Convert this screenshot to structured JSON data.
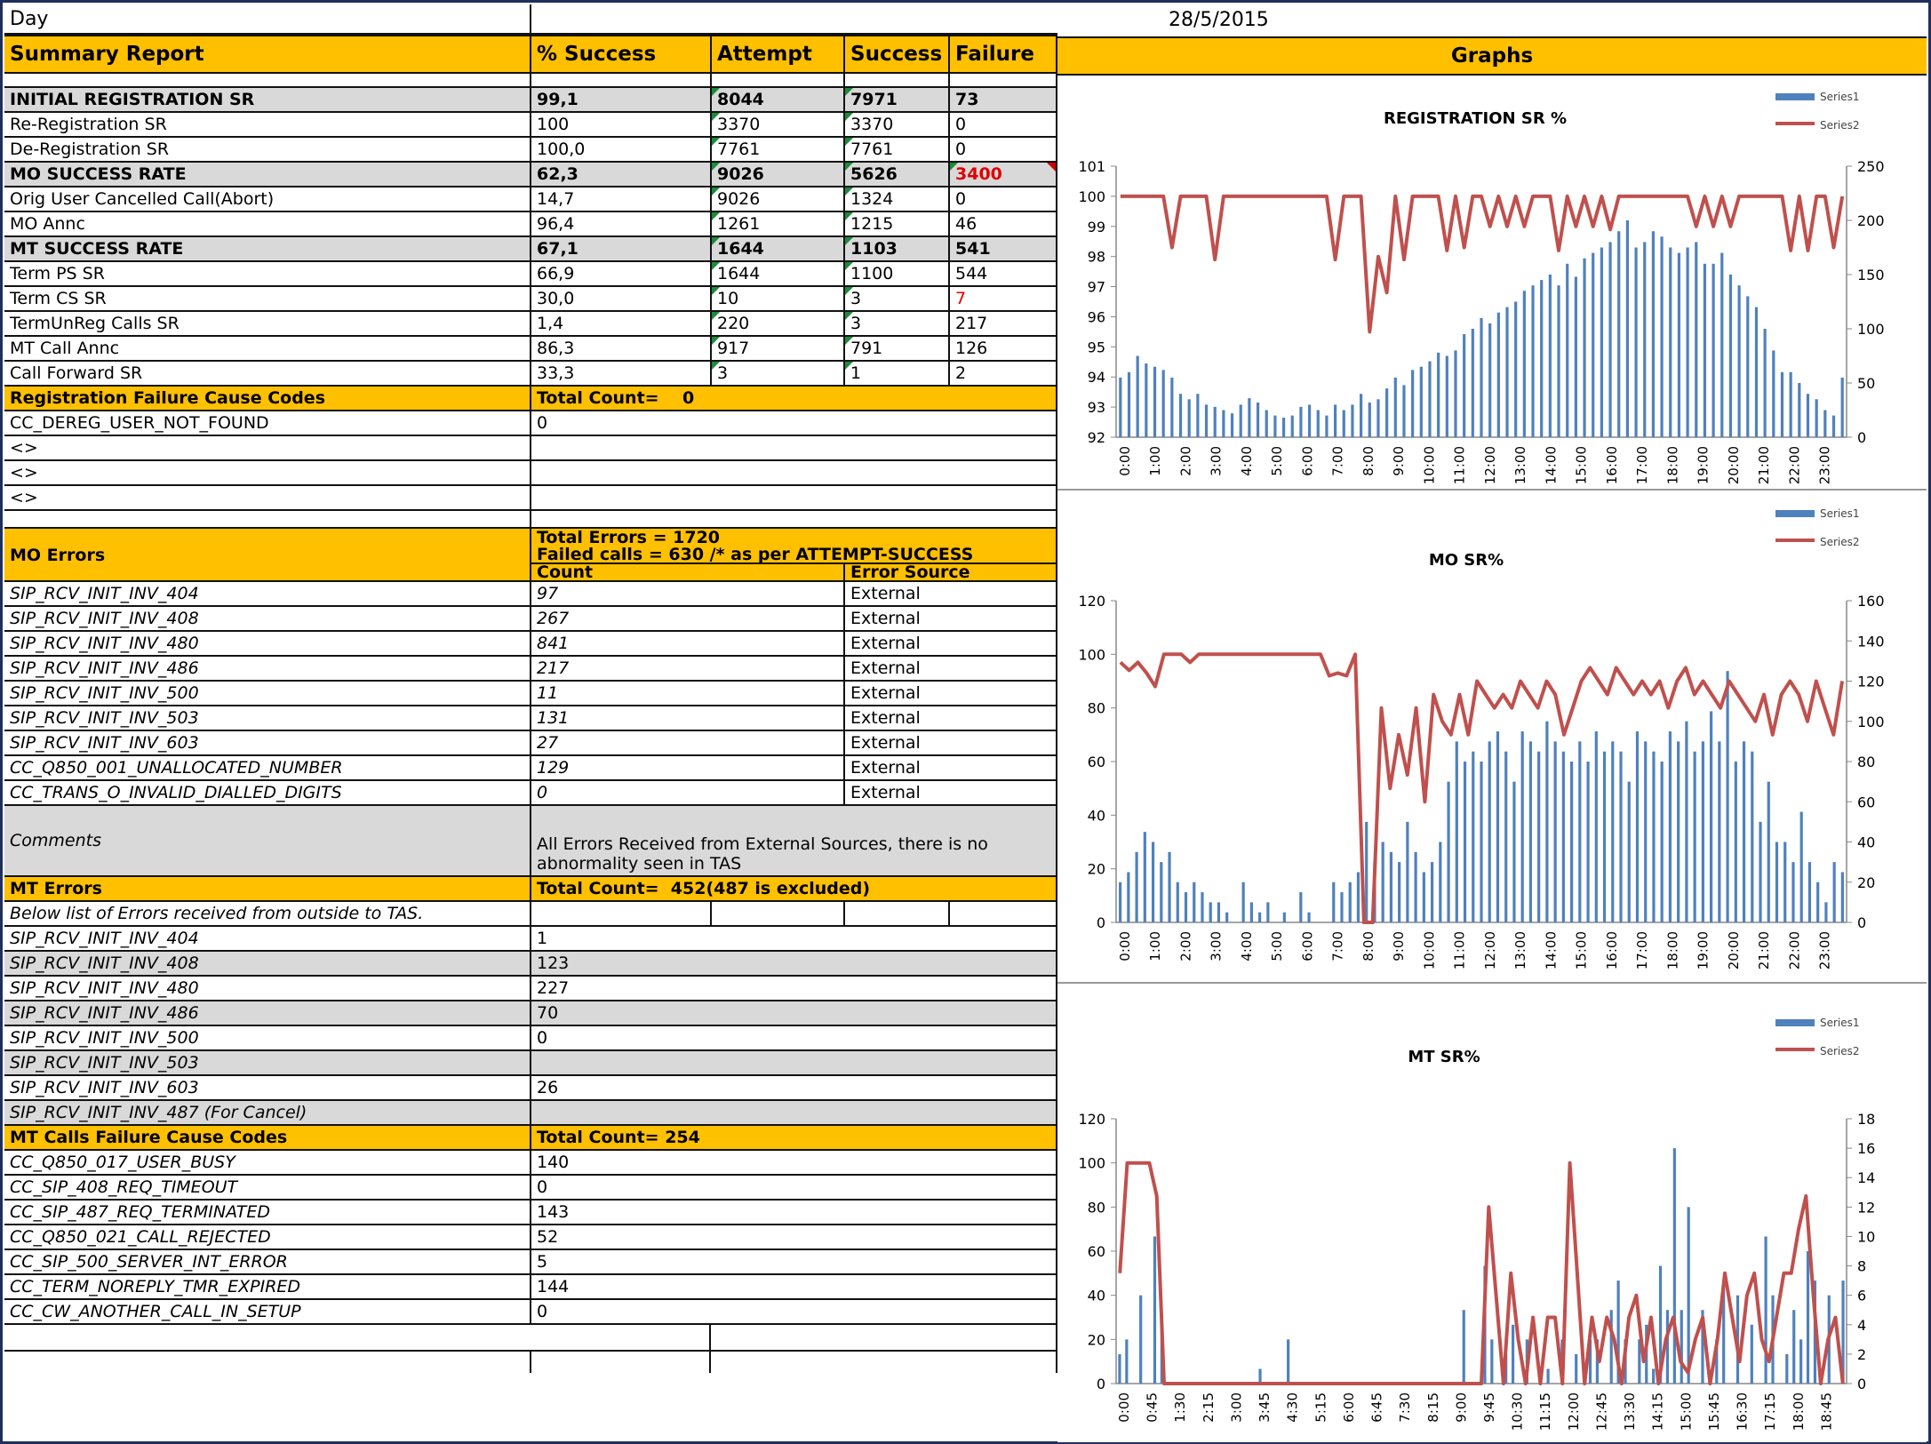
{
  "top": {
    "day_label": "Day",
    "date": "28/5/2015"
  },
  "summary": {
    "headers": [
      "Summary Report",
      "% Success",
      "Attempt",
      "Success",
      "Failure"
    ],
    "rows": [
      {
        "name": "INITIAL REGISTRATION SR",
        "pct": "99,1",
        "attempt": "8044",
        "success": "7971",
        "failure": "73",
        "bold": true
      },
      {
        "name": "Re-Registration SR",
        "pct": "100",
        "attempt": "3370",
        "success": "3370",
        "failure": "0"
      },
      {
        "name": "De-Registration SR",
        "pct": "100,0",
        "attempt": "7761",
        "success": "7761",
        "failure": "0"
      },
      {
        "name": "MO SUCCESS RATE",
        "pct": "62,3",
        "attempt": "9026",
        "success": "5626",
        "failure": "3400",
        "bold": true,
        "redfail": true
      },
      {
        "name": "Orig User Cancelled Call(Abort)",
        "pct": "14,7",
        "attempt": "9026",
        "success": "1324",
        "failure": "0"
      },
      {
        "name": "MO Annc",
        "pct": "96,4",
        "attempt": "1261",
        "success": "1215",
        "failure": "46"
      },
      {
        "name": "MT SUCCESS RATE",
        "pct": "67,1",
        "attempt": "1644",
        "success": "1103",
        "failure": "541",
        "bold": true
      },
      {
        "name": "Term PS SR",
        "pct": "66,9",
        "attempt": "1644",
        "success": "1100",
        "failure": "544"
      },
      {
        "name": "Term CS SR",
        "pct": "30,0",
        "attempt": "10",
        "success": "3",
        "failure": "7",
        "redfail": true
      },
      {
        "name": "TermUnReg Calls SR",
        "pct": "1,4",
        "attempt": "220",
        "success": "3",
        "failure": "217"
      },
      {
        "name": "MT Call Annc",
        "pct": "86,3",
        "attempt": "917",
        "success": "791",
        "failure": "126"
      },
      {
        "name": "Call Forward SR",
        "pct": "33,3",
        "attempt": "3",
        "success": "1",
        "failure": "2"
      }
    ]
  },
  "reg_fail": {
    "title": "Registration Failure Cause Codes",
    "total": "Total Count=    0",
    "rows": [
      {
        "code": "CC_DEREG_USER_NOT_FOUND",
        "value": "0"
      },
      {
        "code": "<>",
        "value": ""
      },
      {
        "code": "<>",
        "value": ""
      },
      {
        "code": "<>",
        "value": ""
      }
    ]
  },
  "mo_errors": {
    "title": "MO Errors",
    "total_errors": "Total Errors =  1720",
    "failed_calls": "Failed calls = 630 /* as per ATTEMPT-SUCCESS",
    "count_header": "Count",
    "source_header": "Error Source",
    "rows": [
      {
        "code": "SIP_RCV_INIT_INV_404",
        "count": "97",
        "source": "External"
      },
      {
        "code": "SIP_RCV_INIT_INV_408",
        "count": "267",
        "source": "External"
      },
      {
        "code": "SIP_RCV_INIT_INV_480",
        "count": "841",
        "source": "External"
      },
      {
        "code": "SIP_RCV_INIT_INV_486",
        "count": "217",
        "source": "External"
      },
      {
        "code": "SIP_RCV_INIT_INV_500",
        "count": "11",
        "source": "External"
      },
      {
        "code": "SIP_RCV_INIT_INV_503",
        "count": "131",
        "source": "External"
      },
      {
        "code": "SIP_RCV_INIT_INV_603",
        "count": "27",
        "source": "External"
      },
      {
        "code": "CC_Q850_001_UNALLOCATED_NUMBER",
        "count": "129",
        "source": "External"
      },
      {
        "code": "CC_TRANS_O_INVALID_DIALLED_DIGITS",
        "count": "0",
        "source": "External"
      }
    ],
    "comments_label": "Comments",
    "comments_line1": "All Errors Received from External Sources, there is no",
    "comments_line2": "abnormality seen in TAS"
  },
  "mt_errors": {
    "title": "MT Errors",
    "total": "Total Count=  452(487 is excluded)",
    "note": "Below list of Errors received from outside to TAS.",
    "rows": [
      {
        "code": "SIP_RCV_INIT_INV_404",
        "value": "1"
      },
      {
        "code": "SIP_RCV_INIT_INV_408",
        "value": "123"
      },
      {
        "code": "SIP_RCV_INIT_INV_480",
        "value": "227"
      },
      {
        "code": "SIP_RCV_INIT_INV_486",
        "value": "70"
      },
      {
        "code": "SIP_RCV_INIT_INV_500",
        "value": "0"
      },
      {
        "code": "SIP_RCV_INIT_INV_503",
        "value": ""
      },
      {
        "code": "SIP_RCV_INIT_INV_603",
        "value": "26"
      },
      {
        "code": "SIP_RCV_INIT_INV_487 (For Cancel)",
        "value": ""
      }
    ]
  },
  "mt_fail": {
    "title": "MT Calls Failure Cause Codes",
    "total": "Total Count= 254",
    "rows": [
      {
        "code": "CC_Q850_017_USER_BUSY",
        "value": "140"
      },
      {
        "code": "CC_SIP_408_REQ_TIMEOUT",
        "value": "0"
      },
      {
        "code": "CC_SIP_487_REQ_TERMINATED",
        "value": "143"
      },
      {
        "code": "CC_Q850_021_CALL_REJECTED",
        "value": "52"
      },
      {
        "code": "CC_SIP_500_SERVER_INT_ERROR",
        "value": "5"
      },
      {
        "code": "CC_TERM_NOREPLY_TMR_EXPIRED",
        "value": "144"
      },
      {
        "code": "CC_CW_ANOTHER_CALL_IN_SETUP",
        "value": "0"
      }
    ]
  },
  "graphs_header": "Graphs",
  "chart_data": [
    {
      "type": "bar+line",
      "title": "REGISTRATION SR %",
      "legend": [
        "Series1",
        "Series2"
      ],
      "left_ticks": [
        "92",
        "93",
        "94",
        "95",
        "96",
        "97",
        "98",
        "99",
        "100",
        "101"
      ],
      "right_ticks": [
        "0",
        "50",
        "100",
        "150",
        "200",
        "250"
      ],
      "xticks": [
        "0:00",
        "1:00",
        "2:00",
        "3:00",
        "4:00",
        "5:00",
        "6:00",
        "7:00",
        "8:00",
        "9:00",
        "10:00",
        "11:00",
        "12:00",
        "13:00",
        "14:00",
        "15:00",
        "16:00",
        "17:00",
        "18:00",
        "19:00",
        "20:00",
        "21:00",
        "22:00",
        "23:00"
      ],
      "yleft": [
        92,
        101
      ],
      "yright": [
        0,
        250
      ],
      "series": [
        {
          "name": "Series1",
          "axis": "right",
          "values": [
            55,
            60,
            75,
            68,
            65,
            62,
            55,
            40,
            35,
            40,
            30,
            28,
            25,
            22,
            30,
            36,
            32,
            25,
            20,
            18,
            20,
            28,
            30,
            25,
            20,
            30,
            25,
            30,
            40,
            32,
            35,
            45,
            55,
            48,
            62,
            65,
            70,
            78,
            75,
            80,
            95,
            100,
            110,
            105,
            115,
            120,
            125,
            135,
            140,
            145,
            150,
            140,
            160,
            148,
            165,
            170,
            175,
            180,
            190,
            200,
            175,
            180,
            190,
            185,
            175,
            170,
            175,
            180,
            160,
            160,
            170,
            150,
            140,
            130,
            120,
            100,
            80,
            60,
            60,
            50,
            40,
            35,
            25,
            20,
            55
          ]
        },
        {
          "name": "Series2",
          "axis": "left",
          "values": [
            100,
            100,
            100,
            100,
            100,
            100,
            98.3,
            100,
            100,
            100,
            100,
            97.9,
            100,
            100,
            100,
            100,
            100,
            100,
            100,
            100,
            100,
            100,
            100,
            100,
            100,
            97.9,
            100,
            100,
            100,
            95.5,
            98.0,
            96.8,
            100,
            97.9,
            100,
            100,
            100,
            100,
            98.2,
            100,
            98.3,
            100,
            100,
            99.0,
            100,
            99.0,
            100,
            99.0,
            100,
            100,
            100,
            98.2,
            100,
            99.0,
            100,
            99.0,
            100,
            98.9,
            100,
            100,
            100,
            100,
            100,
            100,
            100,
            100,
            100,
            99.0,
            100,
            99.0,
            100,
            99.0,
            100,
            100,
            100,
            100,
            100,
            100,
            98.2,
            100,
            98.2,
            100,
            100,
            98.3,
            100
          ]
        }
      ]
    },
    {
      "type": "bar+line",
      "title": "MO SR%",
      "legend": [
        "Series1",
        "Series2"
      ],
      "left_ticks": [
        "0",
        "20",
        "40",
        "60",
        "80",
        "100",
        "120"
      ],
      "right_ticks": [
        "0",
        "20",
        "40",
        "60",
        "80",
        "100",
        "120",
        "140",
        "160"
      ],
      "xticks": [
        "0:00",
        "1:00",
        "2:00",
        "3:00",
        "4:00",
        "5:00",
        "6:00",
        "7:00",
        "8:00",
        "9:00",
        "10:00",
        "11:00",
        "12:00",
        "13:00",
        "14:00",
        "15:00",
        "16:00",
        "17:00",
        "18:00",
        "19:00",
        "20:00",
        "21:00",
        "22:00",
        "23:00"
      ],
      "yleft": [
        0,
        120
      ],
      "yright": [
        0,
        160
      ],
      "series": [
        {
          "name": "Series1",
          "axis": "right",
          "values": [
            20,
            25,
            35,
            45,
            40,
            30,
            35,
            20,
            15,
            20,
            15,
            10,
            10,
            5,
            0,
            20,
            10,
            5,
            10,
            0,
            5,
            0,
            15,
            5,
            0,
            0,
            20,
            15,
            20,
            25,
            50,
            30,
            40,
            35,
            30,
            50,
            35,
            25,
            30,
            40,
            70,
            90,
            80,
            85,
            80,
            90,
            95,
            85,
            70,
            95,
            90,
            85,
            100,
            90,
            85,
            80,
            90,
            80,
            95,
            85,
            90,
            85,
            70,
            95,
            90,
            85,
            80,
            95,
            90,
            100,
            85,
            90,
            105,
            90,
            125,
            80,
            90,
            85,
            50,
            70,
            40,
            40,
            30,
            55,
            30,
            20,
            10,
            30,
            25
          ]
        },
        {
          "name": "Series2",
          "axis": "left",
          "values": [
            97,
            94,
            97,
            93,
            88,
            100,
            100,
            100,
            97,
            100,
            100,
            100,
            100,
            100,
            100,
            100,
            100,
            100,
            100,
            100,
            100,
            100,
            100,
            100,
            92,
            93,
            92,
            100,
            0,
            0,
            80,
            50,
            70,
            55,
            80,
            45,
            85,
            75,
            70,
            85,
            70,
            90,
            85,
            80,
            85,
            80,
            90,
            85,
            80,
            90,
            85,
            70,
            80,
            90,
            95,
            90,
            85,
            95,
            90,
            85,
            90,
            85,
            90,
            80,
            90,
            95,
            85,
            90,
            85,
            80,
            90,
            85,
            80,
            75,
            85,
            70,
            85,
            90,
            85,
            75,
            90,
            80,
            70,
            90
          ]
        }
      ]
    },
    {
      "type": "bar+line",
      "title": "MT SR%",
      "legend": [
        "Series1",
        "Series2"
      ],
      "left_ticks": [
        "0",
        "20",
        "40",
        "60",
        "80",
        "100",
        "120"
      ],
      "right_ticks": [
        "0",
        "2",
        "4",
        "6",
        "8",
        "10",
        "12",
        "14",
        "16",
        "18"
      ],
      "xticks": [
        "0:00",
        "0:45",
        "1:30",
        "2:15",
        "3:00",
        "3:45",
        "4:30",
        "5:15",
        "6:00",
        "6:45",
        "7:30",
        "8:15",
        "9:00",
        "9:45",
        "10:30",
        "11:15",
        "12:00",
        "12:45",
        "13:30",
        "14:15",
        "15:00",
        "15:45",
        "16:30",
        "17:15",
        "18:00",
        "18:45"
      ],
      "yleft": [
        0,
        120
      ],
      "yright": [
        0,
        18
      ],
      "series": [
        {
          "name": "Series1",
          "axis": "right",
          "values": [
            2,
            3,
            0,
            6,
            0,
            10,
            4,
            0,
            0,
            0,
            0,
            0,
            0,
            0,
            0,
            0,
            0,
            0,
            0,
            0,
            1,
            0,
            0,
            0,
            3,
            0,
            0,
            0,
            0,
            0,
            0,
            0,
            0,
            0,
            0,
            0,
            0,
            0,
            0,
            0,
            0,
            0,
            0,
            0,
            0,
            0,
            0,
            0,
            0,
            5,
            0,
            0,
            8,
            3,
            0,
            2,
            4,
            0,
            3,
            0,
            0,
            1,
            0,
            3,
            0,
            2,
            0,
            3,
            3,
            0,
            5,
            7,
            3,
            0,
            3,
            4,
            1,
            8,
            5,
            16,
            5,
            12,
            0,
            5,
            0,
            3,
            7,
            0,
            6,
            0,
            4,
            0,
            10,
            6,
            0,
            2,
            5,
            3,
            9,
            7,
            0,
            6,
            0,
            7
          ]
        },
        {
          "name": "Series2",
          "axis": "left",
          "values": [
            50,
            100,
            100,
            100,
            100,
            85,
            0,
            0,
            0,
            0,
            0,
            0,
            0,
            0,
            0,
            0,
            0,
            0,
            0,
            0,
            0,
            0,
            0,
            0,
            0,
            0,
            0,
            0,
            0,
            0,
            0,
            0,
            0,
            0,
            0,
            0,
            0,
            0,
            0,
            0,
            0,
            0,
            0,
            0,
            0,
            0,
            0,
            0,
            0,
            0,
            80,
            40,
            0,
            50,
            20,
            0,
            30,
            0,
            30,
            30,
            0,
            100,
            50,
            0,
            30,
            10,
            30,
            20,
            0,
            30,
            40,
            10,
            30,
            0,
            20,
            30,
            10,
            5,
            20,
            30,
            0,
            20,
            50,
            30,
            10,
            40,
            50,
            20,
            10,
            30,
            50,
            50,
            70,
            85,
            40,
            0,
            20,
            30,
            0
          ]
        }
      ]
    }
  ]
}
